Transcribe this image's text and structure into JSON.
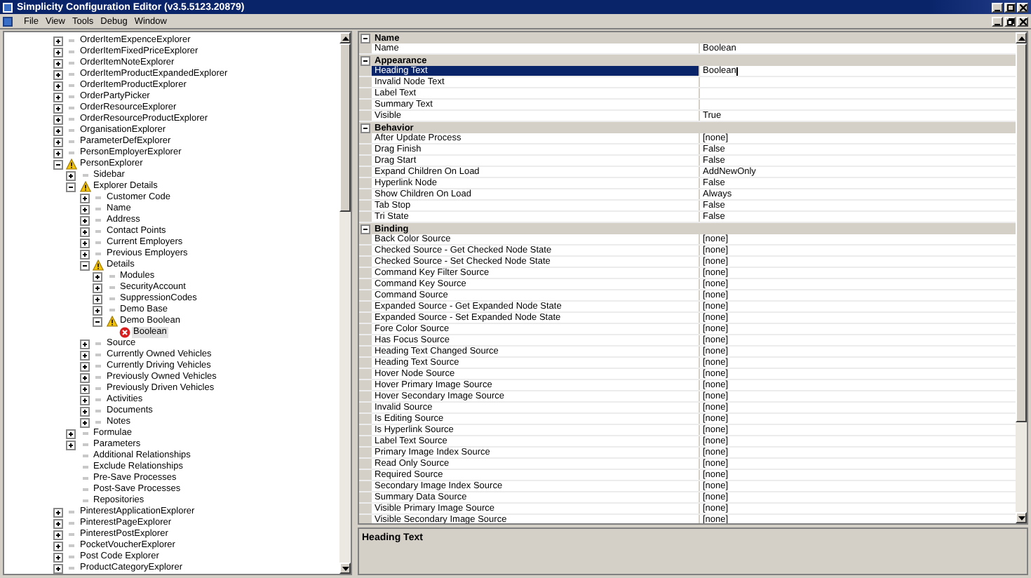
{
  "window": {
    "title": "Simplicity Configuration Editor (v3.5.5123.20879)"
  },
  "menu": [
    "File",
    "View",
    "Tools",
    "Debug",
    "Window"
  ],
  "tree": [
    {
      "label": "OrderItemExpenceExplorer",
      "kind": "plain",
      "expanded": false,
      "selected": false
    },
    {
      "label": "OrderItemFixedPriceExplorer",
      "kind": "plain",
      "expanded": false,
      "selected": false
    },
    {
      "label": "OrderItemNoteExplorer",
      "kind": "plain",
      "expanded": false,
      "selected": false
    },
    {
      "label": "OrderItemProductExpandedExplorer",
      "kind": "plain",
      "expanded": false,
      "selected": false
    },
    {
      "label": "OrderItemProductExplorer",
      "kind": "plain",
      "expanded": false,
      "selected": false
    },
    {
      "label": "OrderPartyPicker",
      "kind": "plain",
      "expanded": false,
      "selected": false
    },
    {
      "label": "OrderResourceExplorer",
      "kind": "plain",
      "expanded": false,
      "selected": false
    },
    {
      "label": "OrderResourceProductExplorer",
      "kind": "plain",
      "expanded": false,
      "selected": false
    },
    {
      "label": "OrganisationExplorer",
      "kind": "plain",
      "expanded": false,
      "selected": false
    },
    {
      "label": "ParameterDefExplorer",
      "kind": "plain",
      "expanded": false,
      "selected": false
    },
    {
      "label": "PersonEmployerExplorer",
      "kind": "plain",
      "expanded": false,
      "selected": false
    },
    {
      "label": "PersonExplorer",
      "kind": "warning",
      "expanded": true,
      "selected": false,
      "children": [
        {
          "label": "Sidebar",
          "kind": "plain",
          "expanded": false,
          "selected": false
        },
        {
          "label": "Explorer Details",
          "kind": "warning",
          "expanded": true,
          "selected": false,
          "children": [
            {
              "label": "Customer Code",
              "kind": "plain",
              "expanded": false,
              "selected": false
            },
            {
              "label": "Name",
              "kind": "plain",
              "expanded": false,
              "selected": false
            },
            {
              "label": "Address",
              "kind": "plain",
              "expanded": false,
              "selected": false
            },
            {
              "label": "Contact Points",
              "kind": "plain",
              "expanded": false,
              "selected": false
            },
            {
              "label": "Current Employers",
              "kind": "plain",
              "expanded": false,
              "selected": false
            },
            {
              "label": "Previous Employers",
              "kind": "plain",
              "expanded": false,
              "selected": false
            },
            {
              "label": "Details",
              "kind": "warning",
              "expanded": true,
              "selected": false,
              "children": [
                {
                  "label": "Modules",
                  "kind": "plain",
                  "expanded": false,
                  "selected": false
                },
                {
                  "label": "SecurityAccount",
                  "kind": "plain",
                  "expanded": false,
                  "selected": false
                },
                {
                  "label": "SuppressionCodes",
                  "kind": "plain",
                  "expanded": false,
                  "selected": false
                },
                {
                  "label": "Demo Base",
                  "kind": "plain",
                  "expanded": false,
                  "selected": false
                },
                {
                  "label": "Demo Boolean",
                  "kind": "warning",
                  "expanded": true,
                  "selected": false,
                  "children": [
                    {
                      "label": "Boolean",
                      "kind": "error",
                      "selected": true
                    }
                  ]
                }
              ]
            },
            {
              "label": "Source",
              "kind": "plain",
              "expanded": false,
              "selected": false
            },
            {
              "label": "Currently Owned Vehicles",
              "kind": "plain",
              "expanded": false,
              "selected": false
            },
            {
              "label": "Currently Driving Vehicles",
              "kind": "plain",
              "expanded": false,
              "selected": false
            },
            {
              "label": "Previously Owned Vehicles",
              "kind": "plain",
              "expanded": false,
              "selected": false
            },
            {
              "label": "Previously Driven Vehicles",
              "kind": "plain",
              "expanded": false,
              "selected": false
            },
            {
              "label": "Activities",
              "kind": "plain",
              "expanded": false,
              "selected": false
            },
            {
              "label": "Documents",
              "kind": "plain",
              "expanded": false,
              "selected": false
            },
            {
              "label": "Notes",
              "kind": "plain",
              "expanded": false,
              "selected": false
            }
          ]
        },
        {
          "label": "Formulae",
          "kind": "plain",
          "expanded": false,
          "selected": false
        },
        {
          "label": "Parameters",
          "kind": "plain",
          "expanded": false,
          "selected": false
        },
        {
          "label": "Additional Relationships",
          "kind": "plain",
          "selected": false
        },
        {
          "label": "Exclude Relationships",
          "kind": "plain",
          "selected": false
        },
        {
          "label": "Pre-Save Processes",
          "kind": "plain",
          "selected": false
        },
        {
          "label": "Post-Save Processes",
          "kind": "plain",
          "selected": false
        },
        {
          "label": "Repositories",
          "kind": "plain",
          "selected": false
        }
      ]
    },
    {
      "label": "PinterestApplicationExplorer",
      "kind": "plain",
      "expanded": false,
      "selected": false
    },
    {
      "label": "PinterestPageExplorer",
      "kind": "plain",
      "expanded": false,
      "selected": false
    },
    {
      "label": "PinterestPostExplorer",
      "kind": "plain",
      "expanded": false,
      "selected": false
    },
    {
      "label": "PocketVoucherExplorer",
      "kind": "plain",
      "expanded": false,
      "selected": false
    },
    {
      "label": "Post Code Explorer",
      "kind": "plain",
      "expanded": false,
      "selected": false
    },
    {
      "label": "ProductCategoryExplorer",
      "kind": "plain",
      "expanded": false,
      "selected": false
    }
  ],
  "properties": [
    {
      "category": "Name",
      "expanded": true,
      "rows": [
        {
          "name": "Name",
          "value": "Boolean",
          "selected": false
        }
      ]
    },
    {
      "category": "Appearance",
      "expanded": true,
      "rows": [
        {
          "name": "Heading Text",
          "value": "Boolean",
          "selected": true
        },
        {
          "name": "Invalid Node Text",
          "selected": false
        },
        {
          "name": "Label Text",
          "selected": false
        },
        {
          "name": "Summary Text",
          "selected": false
        },
        {
          "name": "Visible",
          "value": "True",
          "selected": false
        }
      ]
    },
    {
      "category": "Behavior",
      "expanded": true,
      "rows": [
        {
          "name": "After Update Process",
          "value": "[none]",
          "selected": false
        },
        {
          "name": "Drag Finish",
          "value": "False",
          "selected": false
        },
        {
          "name": "Drag Start",
          "value": "False",
          "selected": false
        },
        {
          "name": "Expand Children On Load",
          "value": "AddNewOnly",
          "selected": false
        },
        {
          "name": "Hyperlink Node",
          "value": "False",
          "selected": false
        },
        {
          "name": "Show Children On Load",
          "value": "Always",
          "selected": false
        },
        {
          "name": "Tab Stop",
          "value": "False",
          "selected": false
        },
        {
          "name": "Tri State",
          "value": "False",
          "selected": false
        }
      ]
    },
    {
      "category": "Binding",
      "expanded": true,
      "rows": [
        {
          "name": "Back Color Source",
          "value": "[none]",
          "selected": false
        },
        {
          "name": "Checked Source - Get Checked Node State",
          "value": "[none]",
          "selected": false
        },
        {
          "name": "Checked Source - Set Checked Node State",
          "value": "[none]",
          "selected": false
        },
        {
          "name": "Command Key Filter Source",
          "value": "[none]",
          "selected": false
        },
        {
          "name": "Command Key Source",
          "value": "[none]",
          "selected": false
        },
        {
          "name": "Command Source",
          "value": "[none]",
          "selected": false
        },
        {
          "name": "Expanded Source - Get Expanded Node State",
          "value": "[none]",
          "selected": false
        },
        {
          "name": "Expanded Source - Set Expanded Node State",
          "value": "[none]",
          "selected": false
        },
        {
          "name": "Fore Color Source",
          "value": "[none]",
          "selected": false
        },
        {
          "name": "Has Focus Source",
          "value": "[none]",
          "selected": false
        },
        {
          "name": "Heading Text Changed Source",
          "value": "[none]",
          "selected": false
        },
        {
          "name": "Heading Text Source",
          "value": "[none]",
          "selected": false
        },
        {
          "name": "Hover Node Source",
          "value": "[none]",
          "selected": false
        },
        {
          "name": "Hover Primary Image Source",
          "value": "[none]",
          "selected": false
        },
        {
          "name": "Hover Secondary Image Source",
          "value": "[none]",
          "selected": false
        },
        {
          "name": "Invalid Source",
          "value": "[none]",
          "selected": false
        },
        {
          "name": "Is Editing Source",
          "value": "[none]",
          "selected": false
        },
        {
          "name": "Is Hyperlink Source",
          "value": "[none]",
          "selected": false
        },
        {
          "name": "Label Text Source",
          "value": "[none]",
          "selected": false
        },
        {
          "name": "Primary Image Index Source",
          "value": "[none]",
          "selected": false
        },
        {
          "name": "Read Only Source",
          "value": "[none]",
          "selected": false
        },
        {
          "name": "Required Source",
          "value": "[none]",
          "selected": false
        },
        {
          "name": "Secondary Image Index Source",
          "value": "[none]",
          "selected": false
        },
        {
          "name": "Summary Data Source",
          "value": "[none]",
          "selected": false
        },
        {
          "name": "Visible Primary Image Source",
          "value": "[none]",
          "selected": false
        },
        {
          "name": "Visible Secondary Image Source",
          "value": "[none]",
          "selected": false
        }
      ]
    }
  ],
  "description": {
    "title": "Heading Text"
  }
}
